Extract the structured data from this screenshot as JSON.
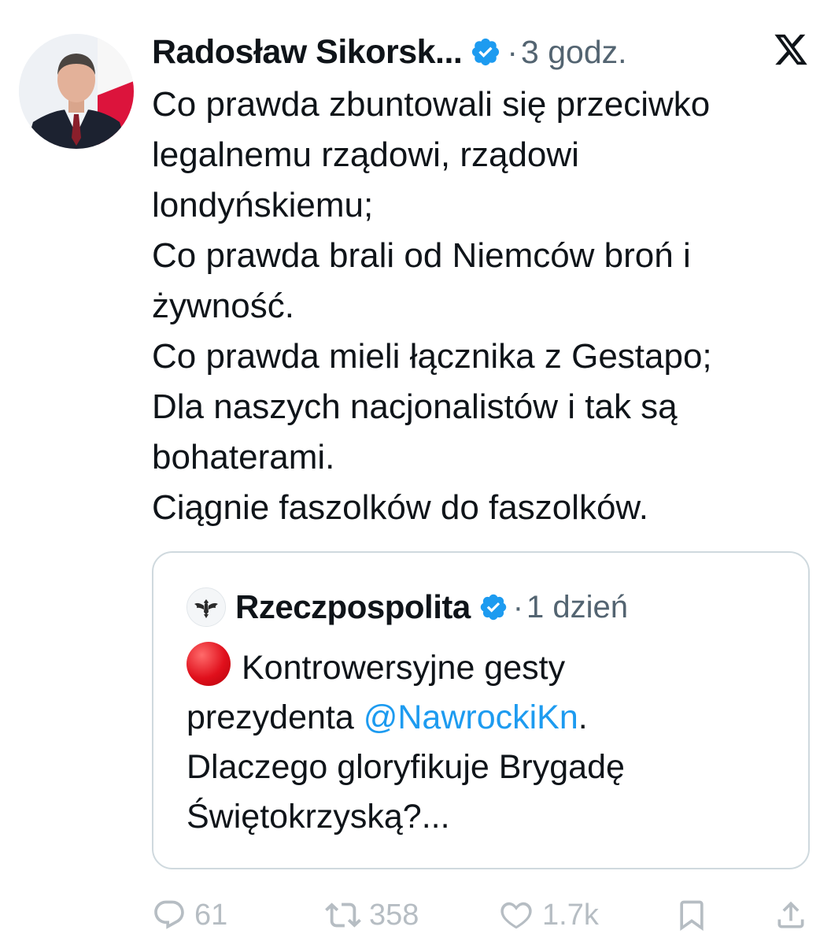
{
  "tweet": {
    "author": {
      "name": "Radosław Sikorsk...",
      "verified": true,
      "avatar": "man-in-suit-with-polish-flag-avatar"
    },
    "time": "3 godz.",
    "separator": "·",
    "platform_icon": "x-logo-icon",
    "text_lines": [
      "Co prawda zbuntowali się przeciwko",
      "legalnemu rządowi, rządowi",
      "londyńskiemu;",
      "Co prawda brali od Niemców broń i",
      "żywność.",
      "Co prawda mieli łącznika z Gestapo;",
      "Dla naszych nacjonalistów i tak są",
      "bohaterami.",
      "Ciągnie faszolków do faszolków."
    ]
  },
  "quoted_tweet": {
    "author": {
      "name": "Rzeczpospolita",
      "verified": true,
      "avatar": "eagle-logo-avatar"
    },
    "separator": "·",
    "time": "1 dzień",
    "emoji": "red-circle-icon",
    "text": {
      "line1": "Kontrowersyjne gesty",
      "line2_prefix": "prezydenta ",
      "mention": "@NawrockiKn",
      "line2_suffix": ".",
      "line3": "Dlaczego gloryfikuje Brygadę",
      "line4": "Świętokrzyską?..."
    }
  },
  "actions": {
    "replies": "61",
    "retweets": "358",
    "likes": "1.7k"
  },
  "colors": {
    "text": "#0f1419",
    "muted": "#536471",
    "verified_badge": "#1d9bf0",
    "mention": "#1d9bf0",
    "border": "#cfd9de"
  }
}
